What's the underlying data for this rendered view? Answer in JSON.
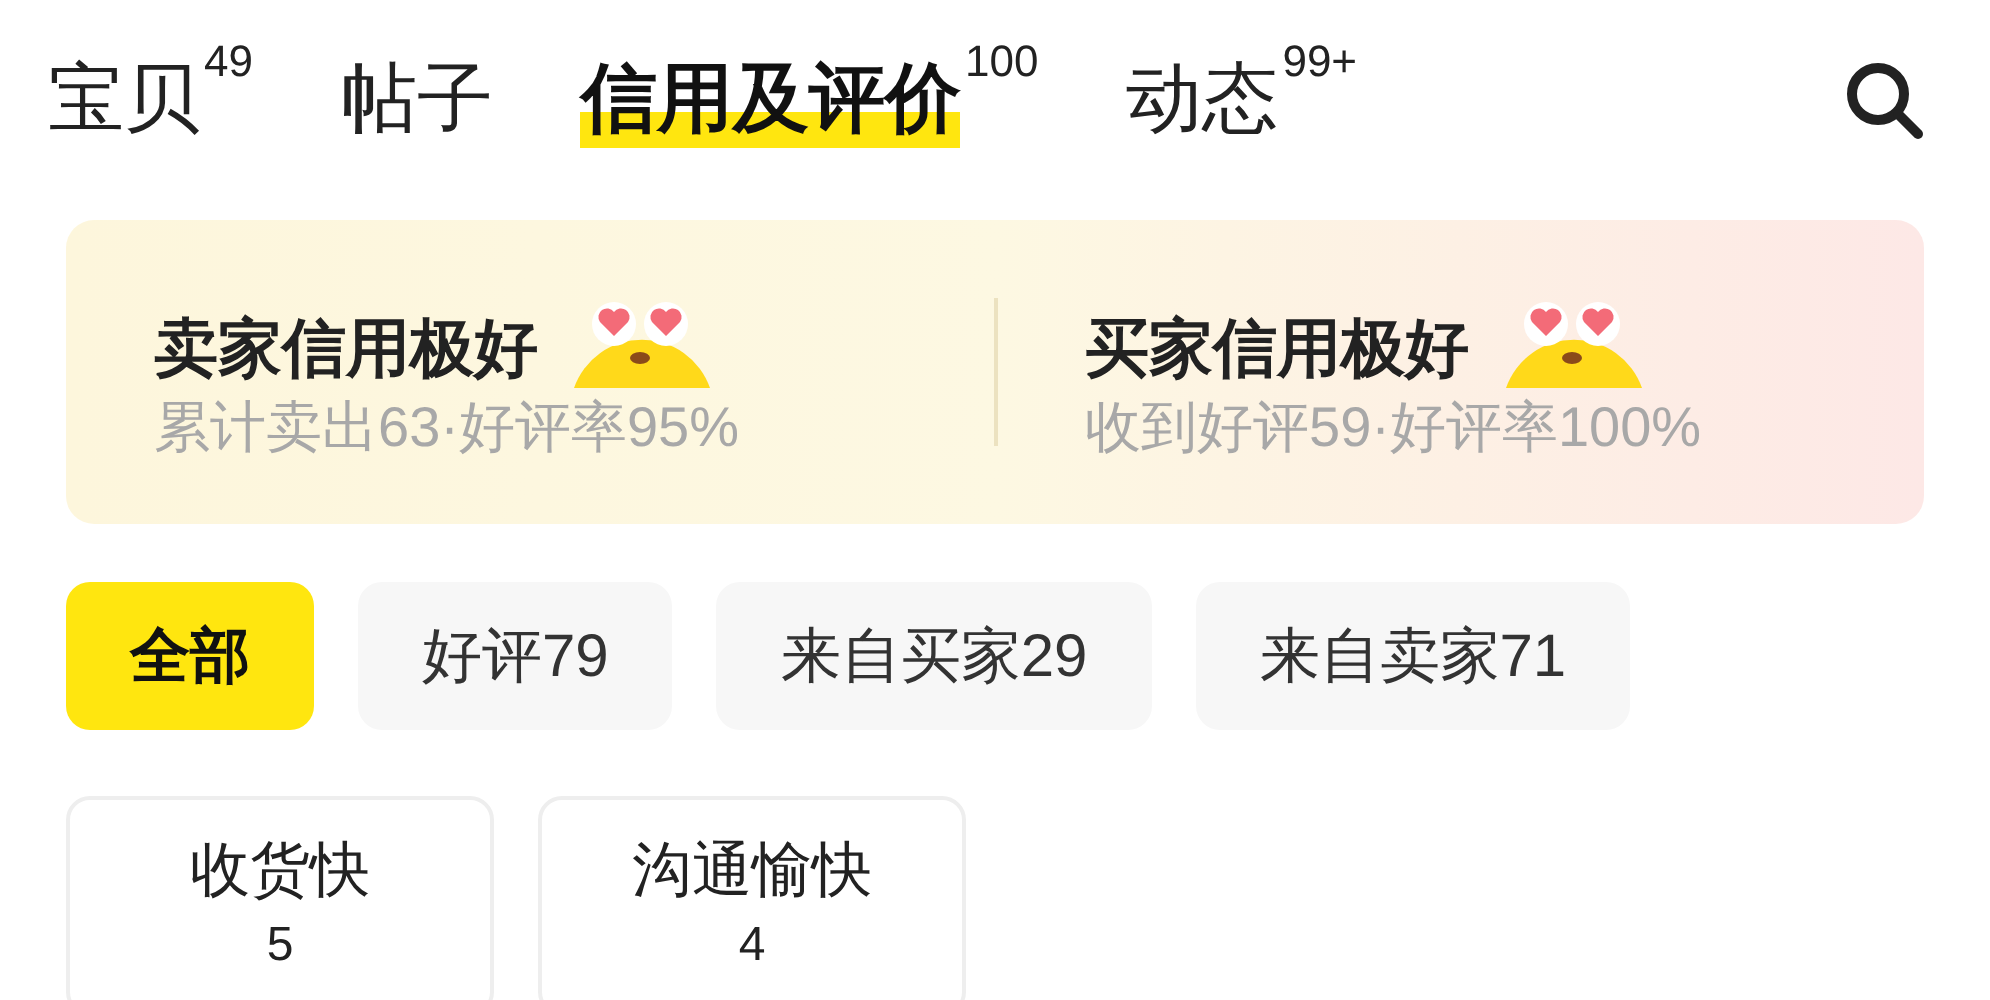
{
  "tabs": [
    {
      "label": "宝贝",
      "count": "49",
      "selected": false
    },
    {
      "label": "帖子",
      "selected": false
    },
    {
      "label": "信用及评价",
      "count": "100",
      "selected": true
    },
    {
      "label": "动态",
      "count": "99+",
      "selected": false
    }
  ],
  "credit": [
    {
      "title": "卖家信用极好",
      "detail": "累计卖出63·好评率95%"
    },
    {
      "title": "买家信用极好",
      "detail": "收到好评59·好评率100%"
    }
  ],
  "filters": [
    {
      "label": "全部",
      "selected": true
    },
    {
      "label": "好评79",
      "selected": false
    },
    {
      "label": "来自买家29",
      "selected": false
    },
    {
      "label": "来自卖家71",
      "selected": false
    }
  ],
  "tags": [
    {
      "label": "收货快",
      "count": "5"
    },
    {
      "label": "沟通愉快",
      "count": "4"
    }
  ]
}
